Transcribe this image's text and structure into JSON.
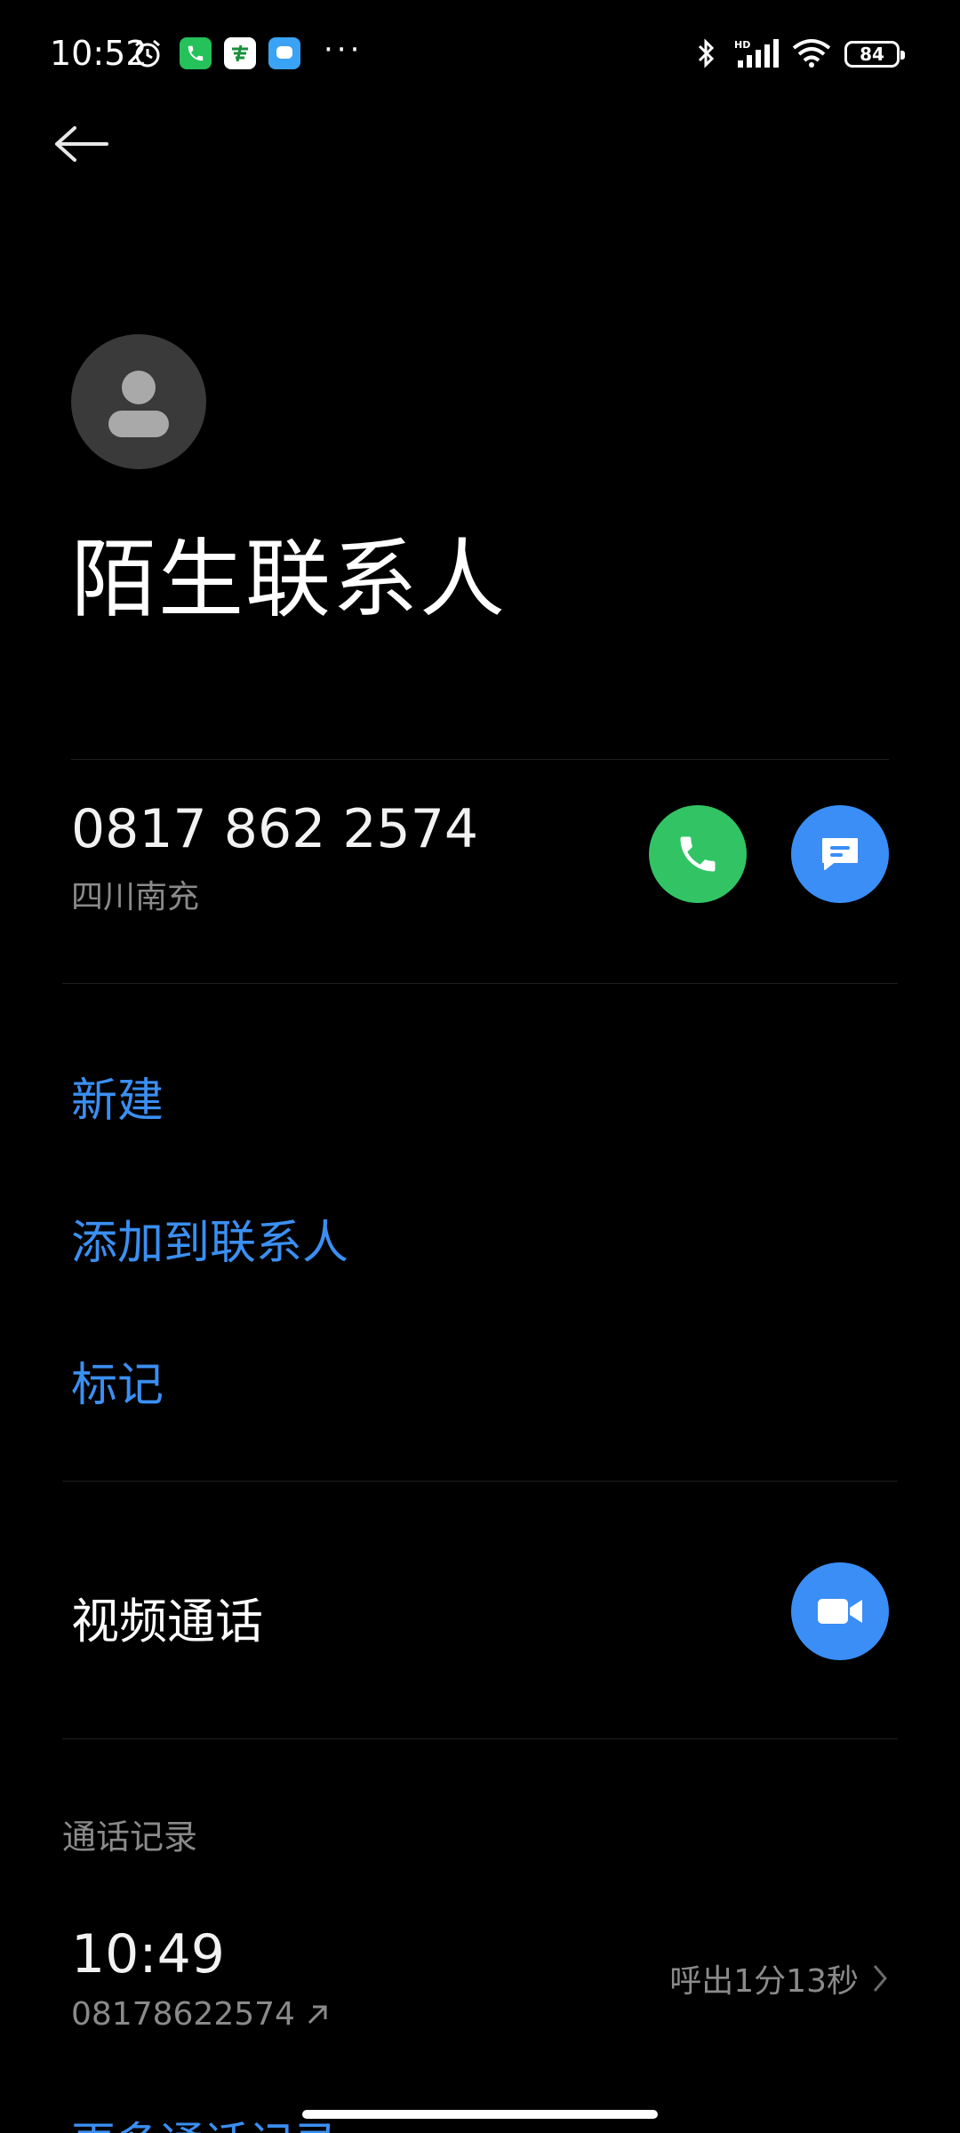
{
  "status_bar": {
    "time": "10:52",
    "battery": "84",
    "icons": [
      "alarm-icon",
      "phone-app-icon",
      "postal-app-icon",
      "message-app-icon",
      "more-dots-icon",
      "bluetooth-icon",
      "hd-signal-icon",
      "wifi-icon",
      "battery-icon"
    ],
    "more": "···"
  },
  "contact": {
    "name": "陌生联系人",
    "avatar_icon": "person-icon"
  },
  "phone": {
    "number": "0817 862 2574",
    "location": "四川南充"
  },
  "actions": {
    "new": "新建",
    "add_to_contacts": "添加到联系人",
    "mark": "标记"
  },
  "video_call": {
    "label": "视频通话"
  },
  "call_log": {
    "header": "通话记录",
    "entries": [
      {
        "time": "10:49",
        "number": "08178622574",
        "detail": "呼出1分13秒"
      }
    ],
    "more": "更多通话记录"
  },
  "colors": {
    "background": "#000000",
    "accent_blue": "#3b8ff2",
    "call_green": "#32c464",
    "secondary_text": "#8a8a8a"
  }
}
